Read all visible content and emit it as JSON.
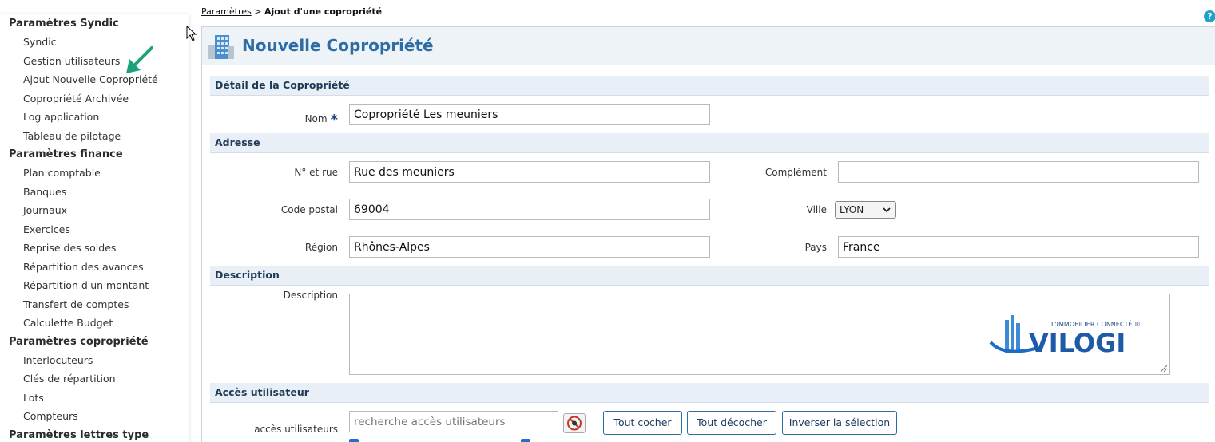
{
  "sidebar": {
    "sections": [
      {
        "title": "Paramètres Syndic",
        "items": [
          "Syndic",
          "Gestion utilisateurs",
          "Ajout Nouvelle Copropriété",
          "Copropriété Archivée",
          "Log application",
          "Tableau de pilotage"
        ]
      },
      {
        "title": "Paramètres finance",
        "items": [
          "Plan comptable",
          "Banques",
          "Journaux",
          "Exercices",
          "Reprise des soldes",
          "Répartition des avances",
          "Répartition d'un montant",
          "Transfert de comptes",
          "Calculette Budget"
        ]
      },
      {
        "title": "Paramètres copropriété",
        "items": [
          "Interlocuteurs",
          "Clés de répartition",
          "Lots",
          "Compteurs"
        ]
      },
      {
        "title": "Paramètres lettres type",
        "items": []
      }
    ]
  },
  "breadcrumb": {
    "root": "Paramètres",
    "sep": " > ",
    "current": "Ajout d'une copropriété"
  },
  "help": {
    "label": "?"
  },
  "panel": {
    "title": "Nouvelle Copropriété"
  },
  "sections": {
    "detail": "Détail de la Copropriété",
    "adresse": "Adresse",
    "description": "Description",
    "acces": "Accès utilisateur"
  },
  "form": {
    "nom": {
      "label": "Nom",
      "value": "Copropriété Les meuniers"
    },
    "rue": {
      "label": "N° et rue",
      "value": "Rue des meuniers"
    },
    "complement": {
      "label": "Complément",
      "value": ""
    },
    "code_postal": {
      "label": "Code postal",
      "value": "69004"
    },
    "ville": {
      "label": "Ville",
      "value": "LYON"
    },
    "region": {
      "label": "Région",
      "value": "Rhônes-Alpes"
    },
    "pays": {
      "label": "Pays",
      "value": "France"
    },
    "description": {
      "label": "Description",
      "value": ""
    },
    "acces": {
      "label": "accès utilisateurs",
      "placeholder": "recherche accès utilisateurs"
    }
  },
  "logo": {
    "tagline": "L'IMMOBILIER CONNECTÉ ®",
    "name": "VILOGI"
  },
  "buttons": {
    "tout_cocher": "Tout cocher",
    "tout_decocher": "Tout décocher",
    "inverser": "Inverser la sélection"
  },
  "colors": {
    "accent": "#2e6da4",
    "section_bg": "#e8eff6",
    "arrow": "#1aa37a"
  }
}
